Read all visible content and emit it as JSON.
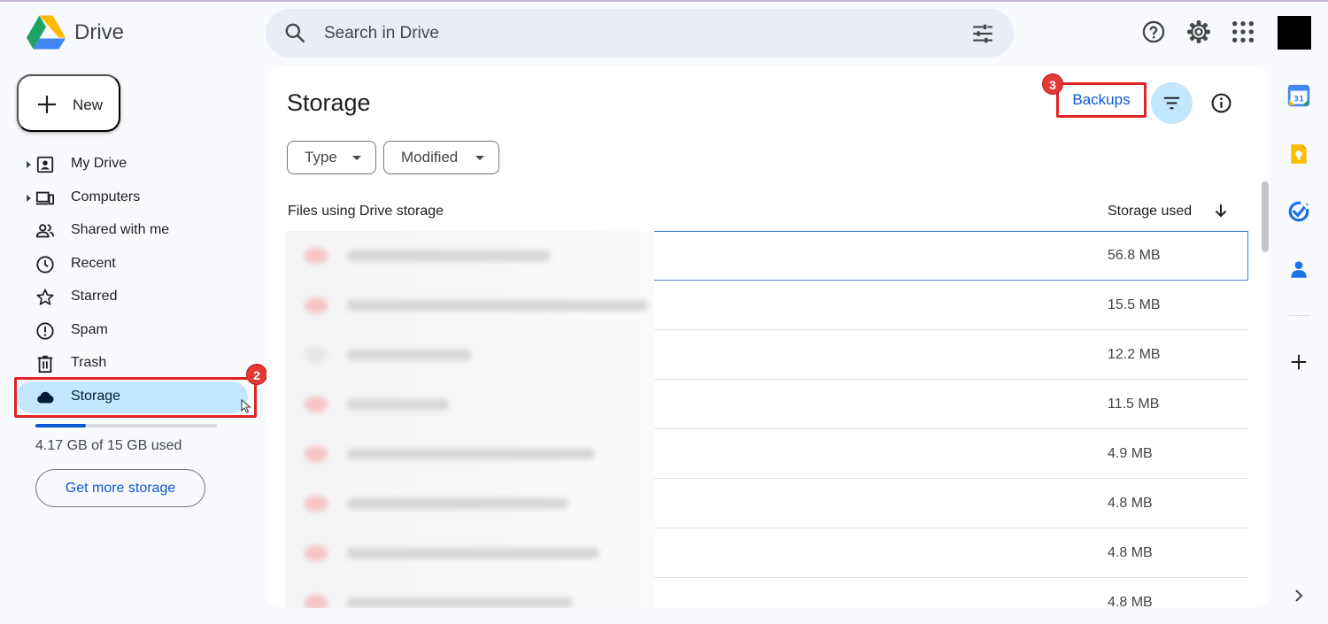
{
  "app": {
    "name": "Drive",
    "brand_colors": {
      "green": "#1ea362",
      "blue": "#4285f4",
      "yellow": "#ffba00",
      "red": "#ea4335"
    }
  },
  "search": {
    "placeholder": "Search in Drive",
    "icon": "search-icon",
    "options_icon": "tune-icon"
  },
  "topbar": {
    "icons": [
      "help-icon",
      "settings-icon",
      "apps-grid-icon"
    ]
  },
  "new_button": {
    "label": "New"
  },
  "sidebar": {
    "items": [
      {
        "label": "My Drive",
        "icon": "my-drive-icon",
        "expandable": true
      },
      {
        "label": "Computers",
        "icon": "computers-icon",
        "expandable": true
      },
      {
        "label": "Shared with me",
        "icon": "shared-icon"
      },
      {
        "label": "Recent",
        "icon": "clock-icon"
      },
      {
        "label": "Starred",
        "icon": "star-icon"
      },
      {
        "label": "Spam",
        "icon": "spam-icon"
      },
      {
        "label": "Trash",
        "icon": "trash-icon"
      },
      {
        "label": "Storage",
        "icon": "cloud-icon",
        "active": true
      }
    ],
    "storage": {
      "used_fraction": 0.278,
      "usage_text": "4.17 GB of 15 GB used",
      "get_more_label": "Get more storage"
    }
  },
  "annotations": {
    "storage_badge": "2",
    "backups_badge": "3",
    "highlight_color": "#e02424"
  },
  "main": {
    "title": "Storage",
    "filters": [
      {
        "label": "Type"
      },
      {
        "label": "Modified"
      }
    ],
    "backups_label": "Backups",
    "columns": {
      "name": "Files using Drive storage",
      "size": "Storage used"
    },
    "files": [
      {
        "size": "56.8 MB"
      },
      {
        "size": "15.5 MB"
      },
      {
        "size": "12.2 MB"
      },
      {
        "size": "11.5 MB"
      },
      {
        "size": "4.9 MB"
      },
      {
        "size": "4.8 MB"
      },
      {
        "size": "4.8 MB"
      },
      {
        "size": "4.8 MB"
      }
    ]
  },
  "side_panel": {
    "apps": [
      "calendar-icon",
      "keep-icon",
      "tasks-icon",
      "contacts-icon"
    ],
    "calendar_day": "31"
  }
}
